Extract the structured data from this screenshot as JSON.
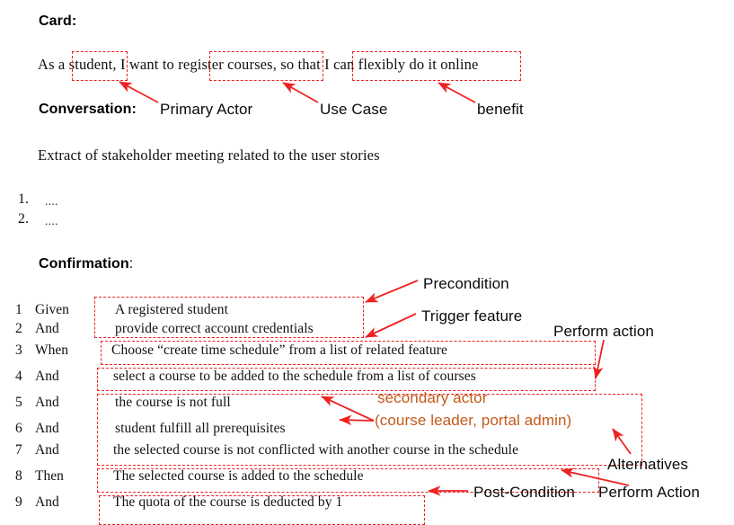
{
  "document": {
    "accent_red": "#EE2222",
    "accent_orange": "#C4591B",
    "text_color": "#111111"
  },
  "sections": {
    "card_heading": "Card:",
    "conversation_heading": "Conversation:",
    "confirmation_heading": "Confirmation",
    "confirmation_colon": ":"
  },
  "card": {
    "full_sentence": "As a student, I want to register courses, so that I can flexibly do it online",
    "fragments": {
      "lead": "As a ",
      "actor": "student,",
      "mid": " I want to ",
      "usecase": "register courses,",
      "mid2": " so that I ",
      "benefit": "can flexibly do it online"
    }
  },
  "card_annotations": [
    {
      "label": "Primary Actor"
    },
    {
      "label": "Use Case"
    },
    {
      "label": "benefit"
    }
  ],
  "conversation": {
    "intro": "Extract of stakeholder meeting related to the user stories",
    "items": [
      {
        "number": "1.",
        "text": "...."
      },
      {
        "number": "2.",
        "text": "...."
      }
    ]
  },
  "confirmation": {
    "rows": [
      {
        "number": "1",
        "keyword": "Given",
        "text": "A registered student"
      },
      {
        "number": "2",
        "keyword": "And",
        "text": "provide correct account credentials"
      },
      {
        "number": "3",
        "keyword": "When",
        "text": "Choose “create time schedule” from a list of related feature"
      },
      {
        "number": "4",
        "keyword": "And",
        "text": "select a course to be added to the schedule from a list of courses"
      },
      {
        "number": "5",
        "keyword": "And",
        "text": "the course is not full"
      },
      {
        "number": "6",
        "keyword": "And",
        "text": "student fulfill all prerequisites"
      },
      {
        "number": "7",
        "keyword": "And",
        "text": "the selected course is not conflicted with another course in the schedule"
      },
      {
        "number": "8",
        "keyword": "Then",
        "text": "The selected course is added to the schedule"
      },
      {
        "number": "9",
        "keyword": "And",
        "text": "The quota of the course is deducted by 1"
      }
    ]
  },
  "confirmation_annotations": {
    "precondition": "Precondition",
    "trigger_feature": "Trigger feature",
    "perform_action_top": "Perform action",
    "secondary_actor_line1": "secondary actor",
    "secondary_actor_line2": "(course leader, portal admin)",
    "alternatives": "Alternatives",
    "post_condition": "Post-Condition",
    "perform_action_bottom": "Perform Action"
  }
}
